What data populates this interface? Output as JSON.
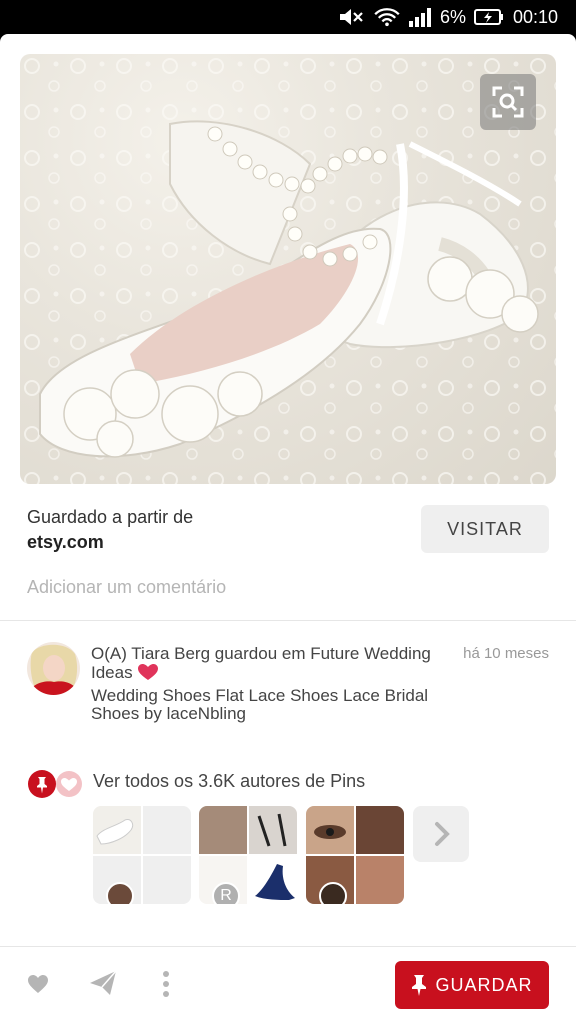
{
  "status_bar": {
    "battery_percent": "6%",
    "time": "00:10"
  },
  "pin": {
    "image_icon": "shoe-photo",
    "visual_search_icon": "visual-search-icon",
    "saved_from_label": "Guardado a partir de",
    "source_site": "etsy.com",
    "visit_label": "VISITAR",
    "comment_placeholder": "Adicionar um comentário"
  },
  "activity": {
    "saved_by": "O(A) Tiara Berg guardou em Future Wedding Ideas",
    "time_ago": "há 10 meses",
    "description": "Wedding Shoes Flat Lace Shoes Lace Bridal Shoes by laceNbling"
  },
  "pinners": {
    "label": "Ver todos os 3.6K autores de Pins",
    "board_badge_letter": "R"
  },
  "actions": {
    "save_label": "GUARDAR"
  },
  "colors": {
    "brand_red": "#c8101e",
    "heart_red": "#e0345b"
  }
}
